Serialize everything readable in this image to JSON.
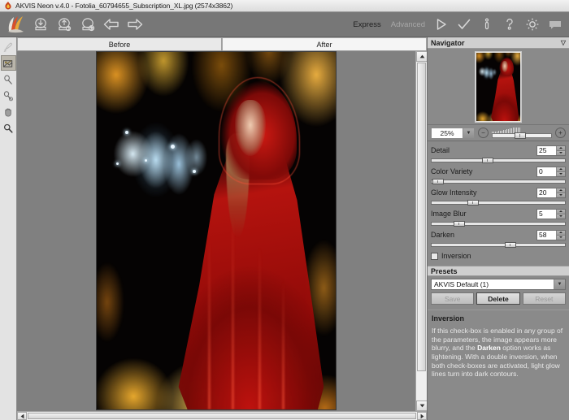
{
  "window": {
    "title": "AKVIS Neon v.4.0 - Fotolia_60794655_Subscription_XL.jpg (2574x3862)",
    "app_icon": "akvis-flame-icon"
  },
  "toolbar": {
    "left_items": [
      {
        "name": "akvis-logo-icon",
        "label": "AKVIS"
      },
      {
        "name": "open-image-icon",
        "label": "Open Image"
      },
      {
        "name": "save-image-icon",
        "label": "Save Image"
      },
      {
        "name": "print-image-icon",
        "label": "Print Image"
      },
      {
        "name": "undo-icon",
        "label": "Undo"
      },
      {
        "name": "redo-icon",
        "label": "Redo"
      }
    ],
    "modes": [
      {
        "label": "Express",
        "active": true
      },
      {
        "label": "Advanced",
        "active": false
      }
    ],
    "right_items": [
      {
        "name": "run-icon",
        "label": "Run"
      },
      {
        "name": "apply-checkmark-icon",
        "label": "Apply"
      },
      {
        "name": "info-icon",
        "label": "Info"
      },
      {
        "name": "help-question-icon",
        "label": "Help"
      },
      {
        "name": "preferences-gear-icon",
        "label": "Preferences"
      },
      {
        "name": "comment-icon",
        "label": "Comments"
      }
    ]
  },
  "tools": [
    {
      "name": "history-brush-tool",
      "label": "History Brush",
      "state": "disabled"
    },
    {
      "name": "quick-preview-tool",
      "label": "Quick Preview",
      "state": "selected"
    },
    {
      "name": "transform-tool",
      "label": "Transform",
      "state": "normal"
    },
    {
      "name": "color-pencil-tool",
      "label": "Color Pencil",
      "state": "normal"
    },
    {
      "name": "hand-tool",
      "label": "Hand",
      "state": "normal"
    },
    {
      "name": "zoom-tool",
      "label": "Zoom",
      "state": "normal"
    }
  ],
  "tabs": [
    {
      "label": "Before",
      "active": false
    },
    {
      "label": "After",
      "active": true
    }
  ],
  "navigator": {
    "title": "Navigator",
    "collapse_icon": "chevron-down-icon",
    "zoom_value": "25%",
    "zoom_out_label": "−",
    "zoom_in_label": "+"
  },
  "settings": {
    "params": [
      {
        "label": "Detail",
        "value": "25",
        "knob_pct": 38
      },
      {
        "label": "Color Variety",
        "value": "0",
        "knob_pct": 2
      },
      {
        "label": "Glow Intensity",
        "value": "20",
        "knob_pct": 27
      },
      {
        "label": "Image Blur",
        "value": "5",
        "knob_pct": 17
      },
      {
        "label": "Darken",
        "value": "58",
        "knob_pct": 55
      }
    ],
    "inversion": {
      "label": "Inversion",
      "checked": false
    }
  },
  "presets": {
    "title": "Presets",
    "selected": "AKVIS Default (1)",
    "dropdown_icon": "chevron-down-icon",
    "buttons": [
      {
        "label": "Save",
        "state": "disabled"
      },
      {
        "label": "Delete",
        "state": "primary"
      },
      {
        "label": "Reset",
        "state": "disabled"
      }
    ]
  },
  "hint": {
    "title": "Inversion",
    "line1": "If this check-box is enabled in any group of the parameters, the image appears more blurry, and the ",
    "bold1": "Darken",
    "line2": " option works as lightening.",
    "line3": "With a double inversion, when both check-boxes are activated, light glow lines turn into dark contours."
  },
  "colors": {
    "toolbar_bg": "#777777",
    "panel_bg": "#8a8a8a",
    "canvas_bg": "#808080",
    "accent_red": "#be120e",
    "accent_blue": "#bce8ff",
    "accent_orange": "#ffb432"
  }
}
